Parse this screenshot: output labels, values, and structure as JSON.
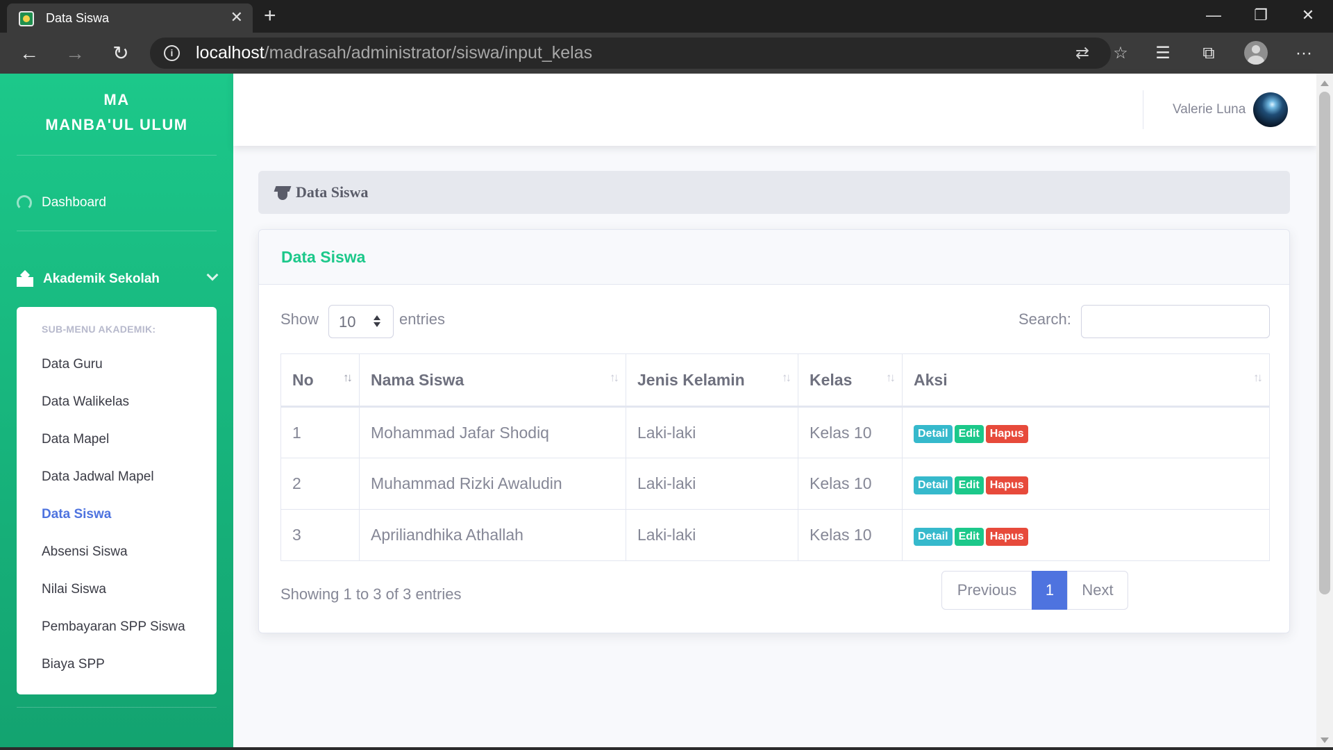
{
  "browser": {
    "tab_title": "Data Siswa",
    "url_host": "localhost",
    "url_path": "/madrasah/administrator/siswa/input_kelas"
  },
  "sidebar": {
    "brand_line1": "MA",
    "brand_line2": "MANBA'UL ULUM",
    "dashboard_label": "Dashboard",
    "section_label": "Akademik Sekolah",
    "submenu_header": "SUB-MENU AKADEMIK:",
    "submenu_items": [
      {
        "label": "Data Guru"
      },
      {
        "label": "Data Walikelas"
      },
      {
        "label": "Data Mapel"
      },
      {
        "label": "Data Jadwal Mapel"
      },
      {
        "label": "Data Siswa",
        "active": true
      },
      {
        "label": "Absensi Siswa"
      },
      {
        "label": "Nilai Siswa"
      },
      {
        "label": "Pembayaran SPP Siswa"
      },
      {
        "label": "Biaya SPP"
      }
    ]
  },
  "topbar": {
    "user_name": "Valerie Luna"
  },
  "page": {
    "heading": "Data Siswa"
  },
  "card": {
    "title": "Data Siswa",
    "length_show": "Show",
    "length_value": "10",
    "length_entries": "entries",
    "search_label": "Search:",
    "search_value": "",
    "columns": [
      "No",
      "Nama Siswa",
      "Jenis Kelamin",
      "Kelas",
      "Aksi"
    ],
    "rows": [
      {
        "no": "1",
        "nama": "Mohammad Jafar Shodiq",
        "jk": "Laki-laki",
        "kelas": "Kelas 10"
      },
      {
        "no": "2",
        "nama": "Muhammad Rizki Awaludin",
        "jk": "Laki-laki",
        "kelas": "Kelas 10"
      },
      {
        "no": "3",
        "nama": "Apriliandhika Athallah",
        "jk": "Laki-laki",
        "kelas": "Kelas 10"
      }
    ],
    "actions": {
      "detail": "Detail",
      "edit": "Edit",
      "hapus": "Hapus"
    },
    "info": "Showing 1 to 3 of 3 entries",
    "pagination": {
      "previous": "Previous",
      "current": "1",
      "next": "Next"
    }
  },
  "colors": {
    "sidebar": "#1cc88a",
    "primary": "#4e73df",
    "detail": "#36b9cc",
    "edit": "#1cc88a",
    "hapus": "#e74a3b"
  }
}
